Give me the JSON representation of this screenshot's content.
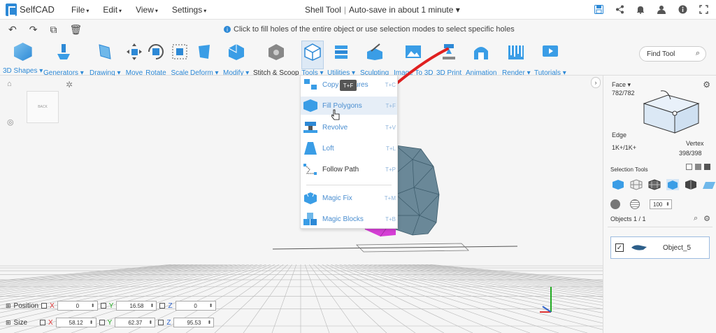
{
  "app": {
    "brand": "SelfCAD",
    "title": "Shell Tool",
    "separator": "|",
    "autosave": "Auto-save in about 1 minute ▾"
  },
  "menu": [
    {
      "label": "File"
    },
    {
      "label": "Edit"
    },
    {
      "label": "View"
    },
    {
      "label": "Settings"
    }
  ],
  "top_icons": [
    "save-icon",
    "share-icon",
    "bell-icon",
    "user-icon",
    "info-icon",
    "expand-icon"
  ],
  "hint": "Click to fill holes of the entire object or use selection modes to select specific holes",
  "hint_tools": [
    "undo-icon",
    "redo-icon",
    "copy-icon",
    "trash-icon"
  ],
  "toolbar": {
    "tools": [
      {
        "label": "3D Shapes ▾"
      },
      {
        "label": "Generators ▾"
      },
      {
        "label": "Drawing ▾"
      },
      {
        "label": "Move"
      },
      {
        "label": "Rotate"
      },
      {
        "label": "Scale"
      },
      {
        "label": "Deform ▾"
      },
      {
        "label": "Modify ▾"
      },
      {
        "label": "Stitch & Scoop"
      },
      {
        "label": "Tools ▾"
      },
      {
        "label": "Utilities ▾"
      },
      {
        "label": "Sculpting"
      },
      {
        "label": "Image To 3D"
      },
      {
        "label": "3D Print"
      },
      {
        "label": "Animation"
      },
      {
        "label": "Render ▾"
      },
      {
        "label": "Tutorials ▾"
      }
    ],
    "search_placeholder": "Find Tool"
  },
  "navcube_label": "BACK",
  "dropdown": {
    "tooltip": "T+F",
    "items": [
      {
        "label": "Copy Features",
        "shortcut": "T+C"
      },
      {
        "label": "Fill Polygons",
        "shortcut": "T+F"
      },
      {
        "label": "Revolve",
        "shortcut": "T+V"
      },
      {
        "label": "Loft",
        "shortcut": "T+L"
      },
      {
        "label": "Follow Path",
        "shortcut": "T+P"
      },
      {
        "label": "Magic Fix",
        "shortcut": "T+M"
      },
      {
        "label": "Magic Blocks",
        "shortcut": "T+B"
      }
    ]
  },
  "transform": {
    "position_label": "Position",
    "size_label": "Size",
    "axes": [
      "X",
      "Y",
      "Z"
    ],
    "position": [
      "0",
      "16.58",
      "0"
    ],
    "size": [
      "58.12",
      "62.37",
      "95.53"
    ]
  },
  "right_panel": {
    "face_label": "Face ▾",
    "face_count": "782/782",
    "edge_label": "Edge",
    "edge_count": "1K+/1K+",
    "vertex_label": "Vertex",
    "vertex_count": "398/398",
    "selection_tools_label": "Selection Tools",
    "brush_size": "100",
    "objects_label": "Objects 1 / 1",
    "object_name": "Object_5",
    "object_checked": "✓"
  },
  "colors": {
    "accent": "#2d89d6",
    "mesh": "#5f7f90",
    "magenta": "#d63fd6",
    "arrow": "#e02020"
  }
}
